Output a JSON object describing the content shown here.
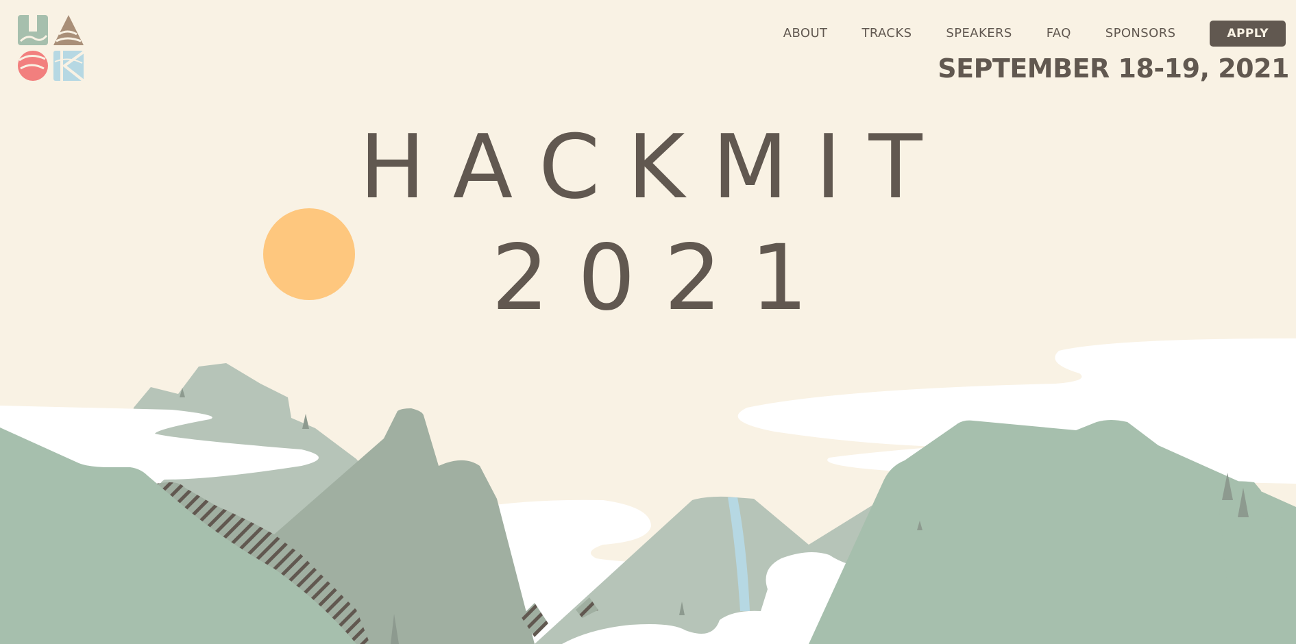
{
  "brand": {
    "logo_icon": "hack-logo-icon",
    "logo_letters": [
      "H",
      "A",
      "C",
      "K"
    ]
  },
  "nav": {
    "items": [
      {
        "label": "ABOUT"
      },
      {
        "label": "TRACKS"
      },
      {
        "label": "SPEAKERS"
      },
      {
        "label": "FAQ"
      },
      {
        "label": "SPONSORS"
      }
    ],
    "apply_label": "APPLY"
  },
  "hero": {
    "title": "HACKMIT",
    "year": "2021",
    "date": "SEPTEMBER 18-19, 2021",
    "sun_icon": "sun-icon",
    "landscape_icon": "mountain-landscape-illustration"
  },
  "colors": {
    "background": "#f9f2e4",
    "text": "#615850",
    "sun": "#fec77e",
    "mountain_light": "#b6c4b8",
    "mountain_mid": "#a0afa1",
    "mountain_front": "#a6bfad",
    "cloud": "#ffffff",
    "water": "#b6d8e3",
    "logo_green": "#a6bfad",
    "logo_brown": "#a98f78",
    "logo_red": "#f27f7e",
    "logo_blue": "#b6d8e3"
  }
}
